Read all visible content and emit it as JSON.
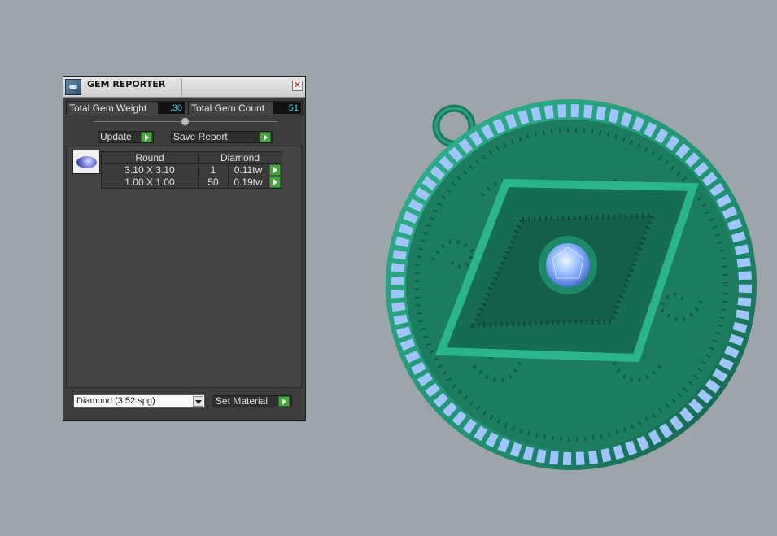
{
  "window": {
    "title": "GEM REPORTER",
    "close_glyph": "✕"
  },
  "stats": {
    "weight_label": "Total Gem Weight",
    "weight_value": ".30",
    "count_label": "Total Gem Count",
    "count_value": "51"
  },
  "buttons": {
    "update": "Update",
    "save_report": "Save Report",
    "set_material": "Set Material"
  },
  "table": {
    "headers": [
      "Round",
      "Diamond"
    ],
    "rows": [
      {
        "size": "3.10 X 3.10",
        "count": "1",
        "weight": "0.11tw"
      },
      {
        "size": "1.00 X 1.00",
        "count": "50",
        "weight": "0.19tw"
      }
    ]
  },
  "material": {
    "selected": "Diamond     (3.52 spg)"
  },
  "icons": {
    "app": "gem-reporter-icon",
    "gem": "round-gem-icon",
    "play": "play-arrow-icon",
    "dropdown": "chevron-down-icon"
  },
  "colors": {
    "accent_green": "#43a83a",
    "value_cyan": "#3fd1d1",
    "pendant_metal": "#1f8f6f",
    "gem_blue": "#8fb8ff",
    "background": "#9ea4ab"
  }
}
